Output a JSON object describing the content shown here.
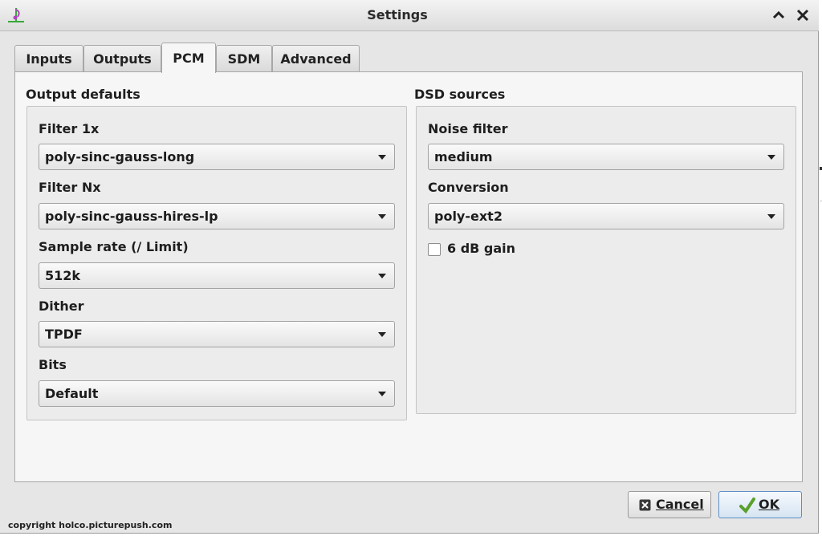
{
  "window": {
    "title": "Settings",
    "icons": {
      "app": "app-logo-icon",
      "up": "chevron-up-icon",
      "close": "close-icon"
    }
  },
  "tabs": [
    {
      "label": "Inputs",
      "active": false
    },
    {
      "label": "Outputs",
      "active": false
    },
    {
      "label": "PCM",
      "active": true
    },
    {
      "label": "SDM",
      "active": false
    },
    {
      "label": "Advanced",
      "active": false
    }
  ],
  "output_defaults": {
    "title": "Output defaults",
    "fields": [
      {
        "label": "Filter 1x",
        "value": "poly-sinc-gauss-long"
      },
      {
        "label": "Filter Nx",
        "value": "poly-sinc-gauss-hires-lp"
      },
      {
        "label": "Sample rate (/ Limit)",
        "value": "512k"
      },
      {
        "label": "Dither",
        "value": "TPDF"
      },
      {
        "label": "Bits",
        "value": "Default"
      }
    ]
  },
  "dsd_sources": {
    "title": "DSD sources",
    "fields": [
      {
        "label": "Noise filter",
        "value": "medium"
      },
      {
        "label": "Conversion",
        "value": "poly-ext2"
      }
    ],
    "gain_checkbox": {
      "label": "6 dB gain",
      "checked": false
    }
  },
  "buttons": {
    "cancel": {
      "label": "Cancel",
      "icon": "cancel-x-icon"
    },
    "ok": {
      "label": "OK",
      "icon": "checkmark-icon"
    }
  },
  "copyright": "copyright holco.picturepush.com",
  "colors": {
    "window_bg": "#e6e6e6",
    "panel_bg": "#f6f6f6",
    "ok_border": "#5d8fc6",
    "check_green": "#5aa02c"
  }
}
